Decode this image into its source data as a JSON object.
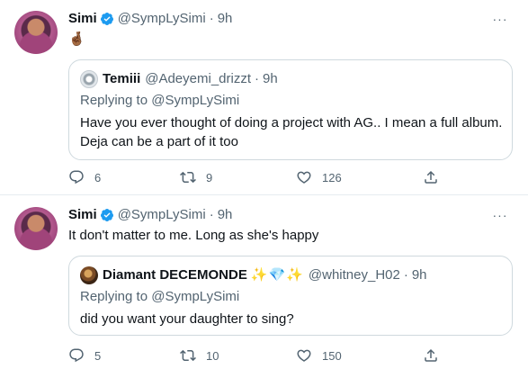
{
  "tweets": [
    {
      "author": {
        "name": "Simi",
        "handle": "@SympLySimi",
        "time": "9h"
      },
      "text": "🤞🏾",
      "quote": {
        "name": "Temiii",
        "emoji": "",
        "handle": "@Adeyemi_drizzt",
        "time": "9h",
        "replying_label": "Replying to",
        "replying_to": "@SympLySimi",
        "text": "Have you ever thought of doing a project with AG.. I mean a full album. Deja can be a part of it too"
      },
      "actions": {
        "replies": "6",
        "retweets": "9",
        "likes": "126"
      }
    },
    {
      "author": {
        "name": "Simi",
        "handle": "@SympLySimi",
        "time": "9h"
      },
      "text": "It don't matter to me. Long as she's happy",
      "quote": {
        "name": "Diamant DECEMONDE",
        "emoji": "✨💎✨",
        "handle": "@whitney_H02",
        "time": "9h",
        "replying_label": "Replying to",
        "replying_to": "@SympLySimi",
        "text": "did you want your daughter to sing?"
      },
      "actions": {
        "replies": "5",
        "retweets": "10",
        "likes": "150"
      }
    }
  ],
  "ui": {
    "more_glyph": "···",
    "dot": "·"
  },
  "colors": {
    "verified": "#1d9bf0",
    "secondary_text": "#536471",
    "border": "#cfd9de"
  }
}
